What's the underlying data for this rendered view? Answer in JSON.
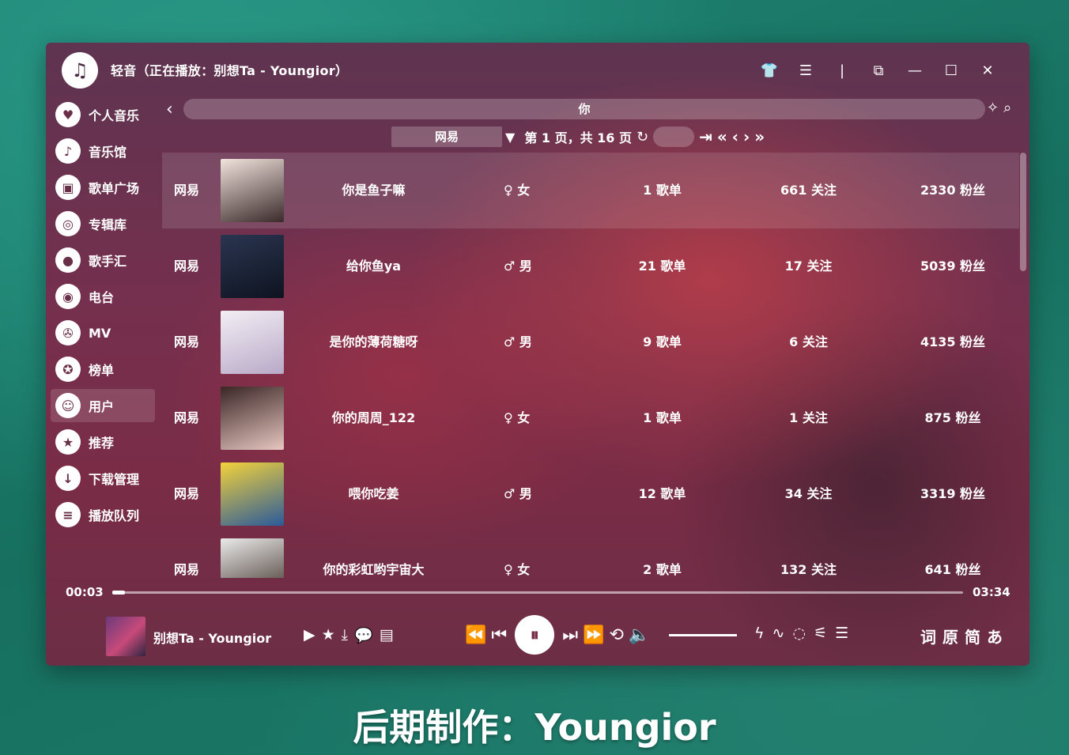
{
  "window": {
    "title": "轻音（正在播放：别想Ta - Youngior）",
    "icons": [
      "shirt-icon",
      "menu-icon",
      "divider",
      "miniplayer-icon",
      "minimize-icon",
      "maximize-icon",
      "close-icon"
    ],
    "icon_glyphs": [
      "👕",
      "☰",
      "|",
      "⧉",
      "—",
      "☐",
      "✕"
    ]
  },
  "sidebar": {
    "items": [
      {
        "label": "个人音乐",
        "glyph": "♥",
        "icon": "heart-icon"
      },
      {
        "label": "音乐馆",
        "glyph": "♪",
        "icon": "music-note-icon"
      },
      {
        "label": "歌单广场",
        "glyph": "▣",
        "icon": "playlist-icon"
      },
      {
        "label": "专辑库",
        "glyph": "◎",
        "icon": "album-icon"
      },
      {
        "label": "歌手汇",
        "glyph": "●",
        "icon": "person-icon"
      },
      {
        "label": "电台",
        "glyph": "◉",
        "icon": "radio-icon"
      },
      {
        "label": "MV",
        "glyph": "✇",
        "icon": "film-reel-icon"
      },
      {
        "label": "榜单",
        "glyph": "✪",
        "icon": "award-icon"
      },
      {
        "label": "用户",
        "glyph": "☺",
        "icon": "user-icon",
        "active": true
      },
      {
        "label": "推荐",
        "glyph": "★",
        "icon": "star-icon"
      },
      {
        "label": "下载管理",
        "glyph": "↓",
        "icon": "download-icon"
      },
      {
        "label": "播放队列",
        "glyph": "≡",
        "icon": "queue-icon"
      }
    ]
  },
  "search": {
    "back_glyph": "‹",
    "query": "你",
    "tools": [
      "✧",
      "⌕"
    ]
  },
  "pager": {
    "source": "网易",
    "page_info": "第 1 页，共 16 页",
    "refresh_glyph": "↻",
    "buttons": [
      "⇥",
      "«",
      "‹",
      "›",
      "»"
    ]
  },
  "users": [
    {
      "source": "网易",
      "name": "你是鱼子嘛",
      "gender": "♀ 女",
      "playlists": "1 歌单",
      "following": "661 关注",
      "fans": "2330 粉丝",
      "colors": [
        "#f1e3dd",
        "#3a2a2a"
      ]
    },
    {
      "source": "网易",
      "name": "给你鱼ya",
      "gender": "♂ 男",
      "playlists": "21 歌单",
      "following": "17 关注",
      "fans": "5039 粉丝",
      "colors": [
        "#2a3550",
        "#0e1320"
      ]
    },
    {
      "source": "网易",
      "name": "是你的薄荷糖呀",
      "gender": "♂ 男",
      "playlists": "9 歌单",
      "following": "6 关注",
      "fans": "4135 粉丝",
      "colors": [
        "#f2eef4",
        "#b9a9c8"
      ]
    },
    {
      "source": "网易",
      "name": "你的周周_122",
      "gender": "♀ 女",
      "playlists": "1 歌单",
      "following": "1 关注",
      "fans": "875 粉丝",
      "colors": [
        "#3a2626",
        "#e7c7c0"
      ]
    },
    {
      "source": "网易",
      "name": "喂你吃姜",
      "gender": "♂ 男",
      "playlists": "12 歌单",
      "following": "34 关注",
      "fans": "3319 粉丝",
      "colors": [
        "#f3d23a",
        "#2a5a9a"
      ]
    },
    {
      "source": "网易",
      "name": "你的彩虹哟宇宙大",
      "gender": "♀ 女",
      "playlists": "2 歌单",
      "following": "132 关注",
      "fans": "641 粉丝",
      "colors": [
        "#eaeaea",
        "#3a2a22"
      ]
    }
  ],
  "player": {
    "current_time": "00:03",
    "total_time": "03:34",
    "progress": 0.015,
    "track": "别想Ta - Youngior",
    "actions": [
      "▶",
      "★",
      "⤓",
      "💬",
      "▤"
    ],
    "controls": [
      "⏪",
      "⏮",
      "⏸",
      "⏭",
      "⏩",
      "⟲",
      "🔈"
    ],
    "extras": [
      "ϟ",
      "∿",
      "◌",
      "⚟",
      "☰"
    ],
    "lyric_buttons": [
      "词",
      "原",
      "简",
      "あ"
    ]
  },
  "caption": "后期制作：Youngior"
}
